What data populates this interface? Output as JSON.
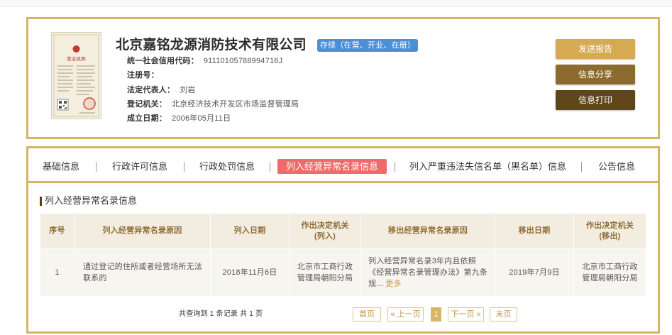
{
  "theme": {
    "gold": "#d5b466",
    "active_tab": "#ef6b6b",
    "status_blue": "#4b8fd7",
    "btn_send": "#d6aa52",
    "btn_share": "#8d6a2d",
    "btn_print": "#5e451a",
    "table_header_bg": "#f2ece1",
    "table_header_text": "#8f6d33",
    "table_row_bg": "#f7f5f0",
    "link_gold": "#c79a42",
    "section_bar": "#5a3e12"
  },
  "company": {
    "license_image": {
      "icon": "business-license-image",
      "title": "营业执照"
    },
    "name": "北京嘉铭龙源消防技术有限公司",
    "status": "存续（在营、开业、在册）",
    "fields": [
      {
        "label": "统一社会信用代码：",
        "value": "91110105788994716J"
      },
      {
        "label": "注册号：",
        "value": ""
      },
      {
        "label": "法定代表人：",
        "value": "刘岩"
      },
      {
        "label": "登记机关：",
        "value": "北京经济技术开发区市场监督管理局"
      },
      {
        "label": "成立日期：",
        "value": "2006年05月11日"
      }
    ]
  },
  "actions": {
    "send_report": "发送报告",
    "share": "信息分享",
    "print": "信息打印"
  },
  "tabs": [
    {
      "label": "基础信息",
      "active": false
    },
    {
      "label": "行政许可信息",
      "active": false
    },
    {
      "label": "行政处罚信息",
      "active": false
    },
    {
      "label": "列入经营异常名录信息",
      "active": true
    },
    {
      "label": "列入严重违法失信名单（黑名单）信息",
      "active": false
    },
    {
      "label": "公告信息",
      "active": false
    }
  ],
  "section": {
    "title": "列入经营异常名录信息"
  },
  "table": {
    "headers": [
      "序号",
      "列入经营异常名录原因",
      "列入日期",
      "作出决定机关(列入)",
      "移出经营异常名录原因",
      "移出日期",
      "作出决定机关(移出)"
    ],
    "rows": [
      {
        "index": "1",
        "listing_reason": "通过登记的住所或者经营场所无法联系的",
        "listing_date": "2018年11月6日",
        "listing_authority": "北京市工商行政管理局朝阳分局",
        "removal_reason": "列入经营异常名录3年内且依照《经营异常名录管理办法》第九条规...",
        "more_label": "更多",
        "removal_date": "2019年7月9日",
        "removal_authority": "北京市工商行政管理局朝阳分局"
      }
    ]
  },
  "pagination": {
    "summary": "共查询到 1 条记录 共 1 页",
    "first": "首页",
    "prev": "« 上一页",
    "current": "1",
    "next": "下一页 »",
    "last": "末页"
  }
}
